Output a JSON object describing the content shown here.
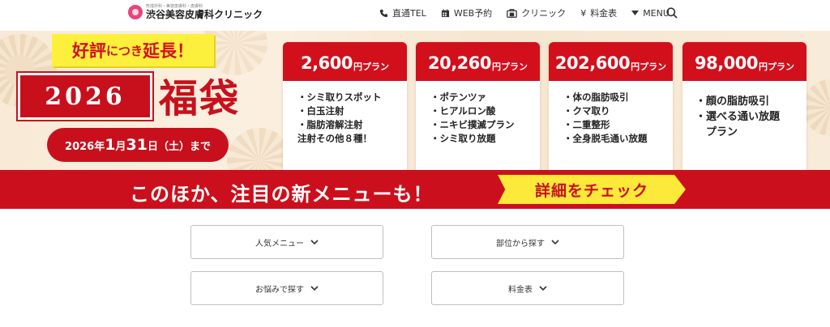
{
  "header": {
    "logo": {
      "sub": "形成外科・美容皮膚科・皮膚科",
      "name": "渋谷美容皮膚科クリニック"
    },
    "nav": [
      {
        "icon": "phone-icon",
        "label": "直通TEL"
      },
      {
        "icon": "calendar-icon",
        "label": "WEB予約"
      },
      {
        "icon": "clinic-icon",
        "label": "クリニック"
      },
      {
        "icon": "yen-icon",
        "label": "料金表"
      },
      {
        "icon": "caret-down-icon",
        "label": "MENU"
      }
    ]
  },
  "banner": {
    "badge_main": "好評",
    "badge_small": "につき",
    "badge_end": "延長！",
    "year": "2026",
    "title": "福袋",
    "date_pre": "2026年",
    "date_month": "1",
    "date_mid": "月",
    "date_day": "31",
    "date_post": "日（土）まで",
    "plans": [
      {
        "price": "2,600",
        "unit": "円プラン",
        "items": [
          "・シミ取りスポット",
          "・白玉注射",
          "・脂肪溶解注射",
          "注射その他８種！"
        ]
      },
      {
        "price": "20,260",
        "unit": "円プラン",
        "items": [
          "・ポテンツァ",
          "・ヒアルロン酸",
          "・ニキビ撲滅プラン",
          "・シミ取り放題"
        ]
      },
      {
        "price": "202,600",
        "unit": "円プラン",
        "items": [
          "・体の脂肪吸引",
          "・クマ取り",
          "・二重整形",
          "・全身脱毛通い放題"
        ]
      },
      {
        "price": "98,000",
        "unit": "円プラン",
        "items": [
          "・顔の脂肪吸引",
          "・選べる通い放題",
          "　プラン"
        ]
      }
    ],
    "ribbon_text": "このほか、注目の新メニューも！",
    "check_label": "詳細をチェック"
  },
  "menus": [
    {
      "label": "人気メニュー"
    },
    {
      "label": "部位から探す"
    },
    {
      "label": "お悩みで探す"
    },
    {
      "label": "料金表"
    }
  ],
  "colors": {
    "brand_red": "#cc0f1c",
    "accent_yellow": "#fde93a",
    "logo_pink": "#e8457a"
  }
}
